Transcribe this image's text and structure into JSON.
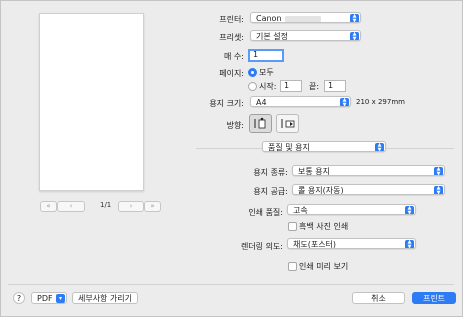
{
  "preview": {
    "page_label": "1/1"
  },
  "printer": {
    "label": "프린터:",
    "value": "Canon"
  },
  "preset": {
    "label": "프리셋:",
    "value": "기본 설정"
  },
  "copies": {
    "label": "매 수:",
    "value": "1"
  },
  "pages": {
    "label": "페이지:",
    "all_label": "모두",
    "from_label": "시작:",
    "from_value": "1",
    "to_label": "끝:",
    "to_value": "1"
  },
  "paper_size": {
    "label": "용지 크기:",
    "value": "A4",
    "dimensions": "210 x 297mm"
  },
  "orientation": {
    "label": "방향:"
  },
  "section": {
    "value": "품질 및 용지"
  },
  "media_type": {
    "label": "용지 종류:",
    "value": "보통 용지"
  },
  "paper_source": {
    "label": "용지 공급:",
    "value": "롤 용지(자동)"
  },
  "print_quality": {
    "label": "인쇄 품질:",
    "value": "고속"
  },
  "grayscale": {
    "label": "흑백 사진 인쇄"
  },
  "rendering": {
    "label": "렌더링 의도:",
    "value": "채도(포스터)"
  },
  "print_preview": {
    "label": "인쇄 미리 보기"
  },
  "footer": {
    "help": "?",
    "pdf": "PDF",
    "hide_details": "세부사항 가리기",
    "cancel": "취소",
    "print": "프린트"
  },
  "colors": {
    "accent": "#2d7cf6"
  }
}
